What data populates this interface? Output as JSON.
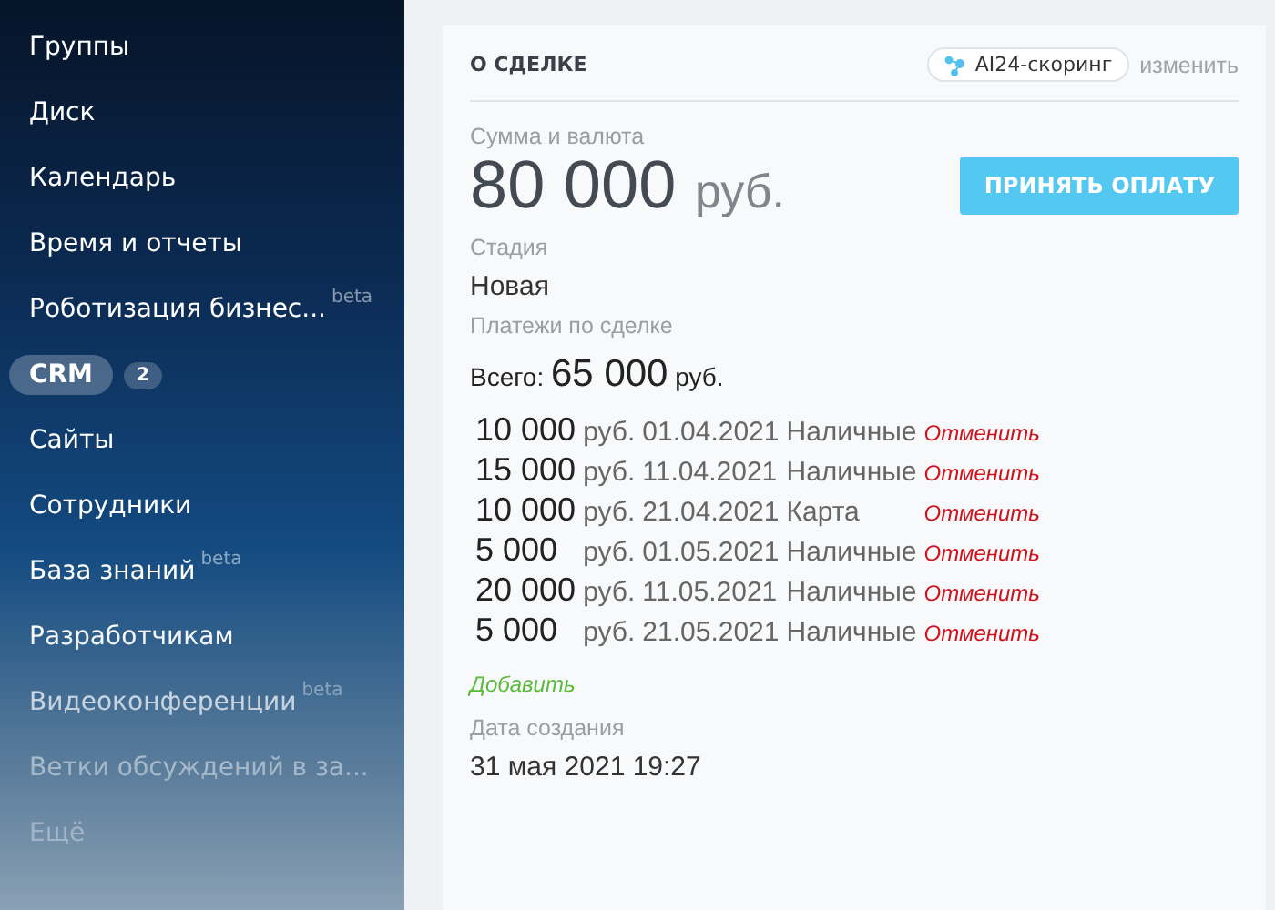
{
  "sidebar": {
    "items": [
      {
        "label": "Группы",
        "selected": false
      },
      {
        "label": "Диск",
        "selected": false
      },
      {
        "label": "Календарь",
        "selected": false
      },
      {
        "label": "Время и отчеты",
        "selected": false
      },
      {
        "label": "Роботизация бизнес...",
        "badge": "beta",
        "selected": false
      },
      {
        "label": "CRM",
        "selected": true,
        "counter": "2"
      },
      {
        "label": "Сайты",
        "selected": false
      },
      {
        "label": "Сотрудники",
        "selected": false
      },
      {
        "label": "База знаний",
        "badge": "beta",
        "selected": false
      },
      {
        "label": "Разработчикам",
        "selected": false
      },
      {
        "label": "Видеоконференции",
        "badge": "beta",
        "selected": false
      },
      {
        "label": "Ветки обсуждений в за...",
        "selected": false
      },
      {
        "label": "Ещё",
        "selected": false
      }
    ]
  },
  "card": {
    "title": "О СДЕЛКЕ",
    "scoring": "AI24-скоринг",
    "edit": "изменить",
    "amount_label": "Сумма и валюта",
    "amount": "80 000",
    "currency": "руб.",
    "pay_button": "ПРИНЯТЬ ОПЛАТУ",
    "stage_label": "Стадия",
    "stage": "Новая",
    "payments_label": "Платежи по сделке",
    "total_label": "Всего:",
    "total": "65 000",
    "total_currency": "руб.",
    "payments": [
      {
        "amount": "10 000",
        "currency": "руб.",
        "date": "01.04.2021",
        "method": "Наличные",
        "cancel": "Отменить"
      },
      {
        "amount": "15 000",
        "currency": "руб.",
        "date": "11.04.2021",
        "method": "Наличные",
        "cancel": "Отменить"
      },
      {
        "amount": "10 000",
        "currency": "руб.",
        "date": "21.04.2021",
        "method": "Карта",
        "cancel": "Отменить"
      },
      {
        "amount": "5 000",
        "currency": "руб.",
        "date": "01.05.2021",
        "method": "Наличные",
        "cancel": "Отменить"
      },
      {
        "amount": "20 000",
        "currency": "руб.",
        "date": "11.05.2021",
        "method": "Наличные",
        "cancel": "Отменить"
      },
      {
        "amount": "5 000",
        "currency": "руб.",
        "date": "21.05.2021",
        "method": "Наличные",
        "cancel": "Отменить"
      }
    ],
    "add": "Добавить",
    "created_label": "Дата создания",
    "created": "31 мая 2021 19:27"
  }
}
